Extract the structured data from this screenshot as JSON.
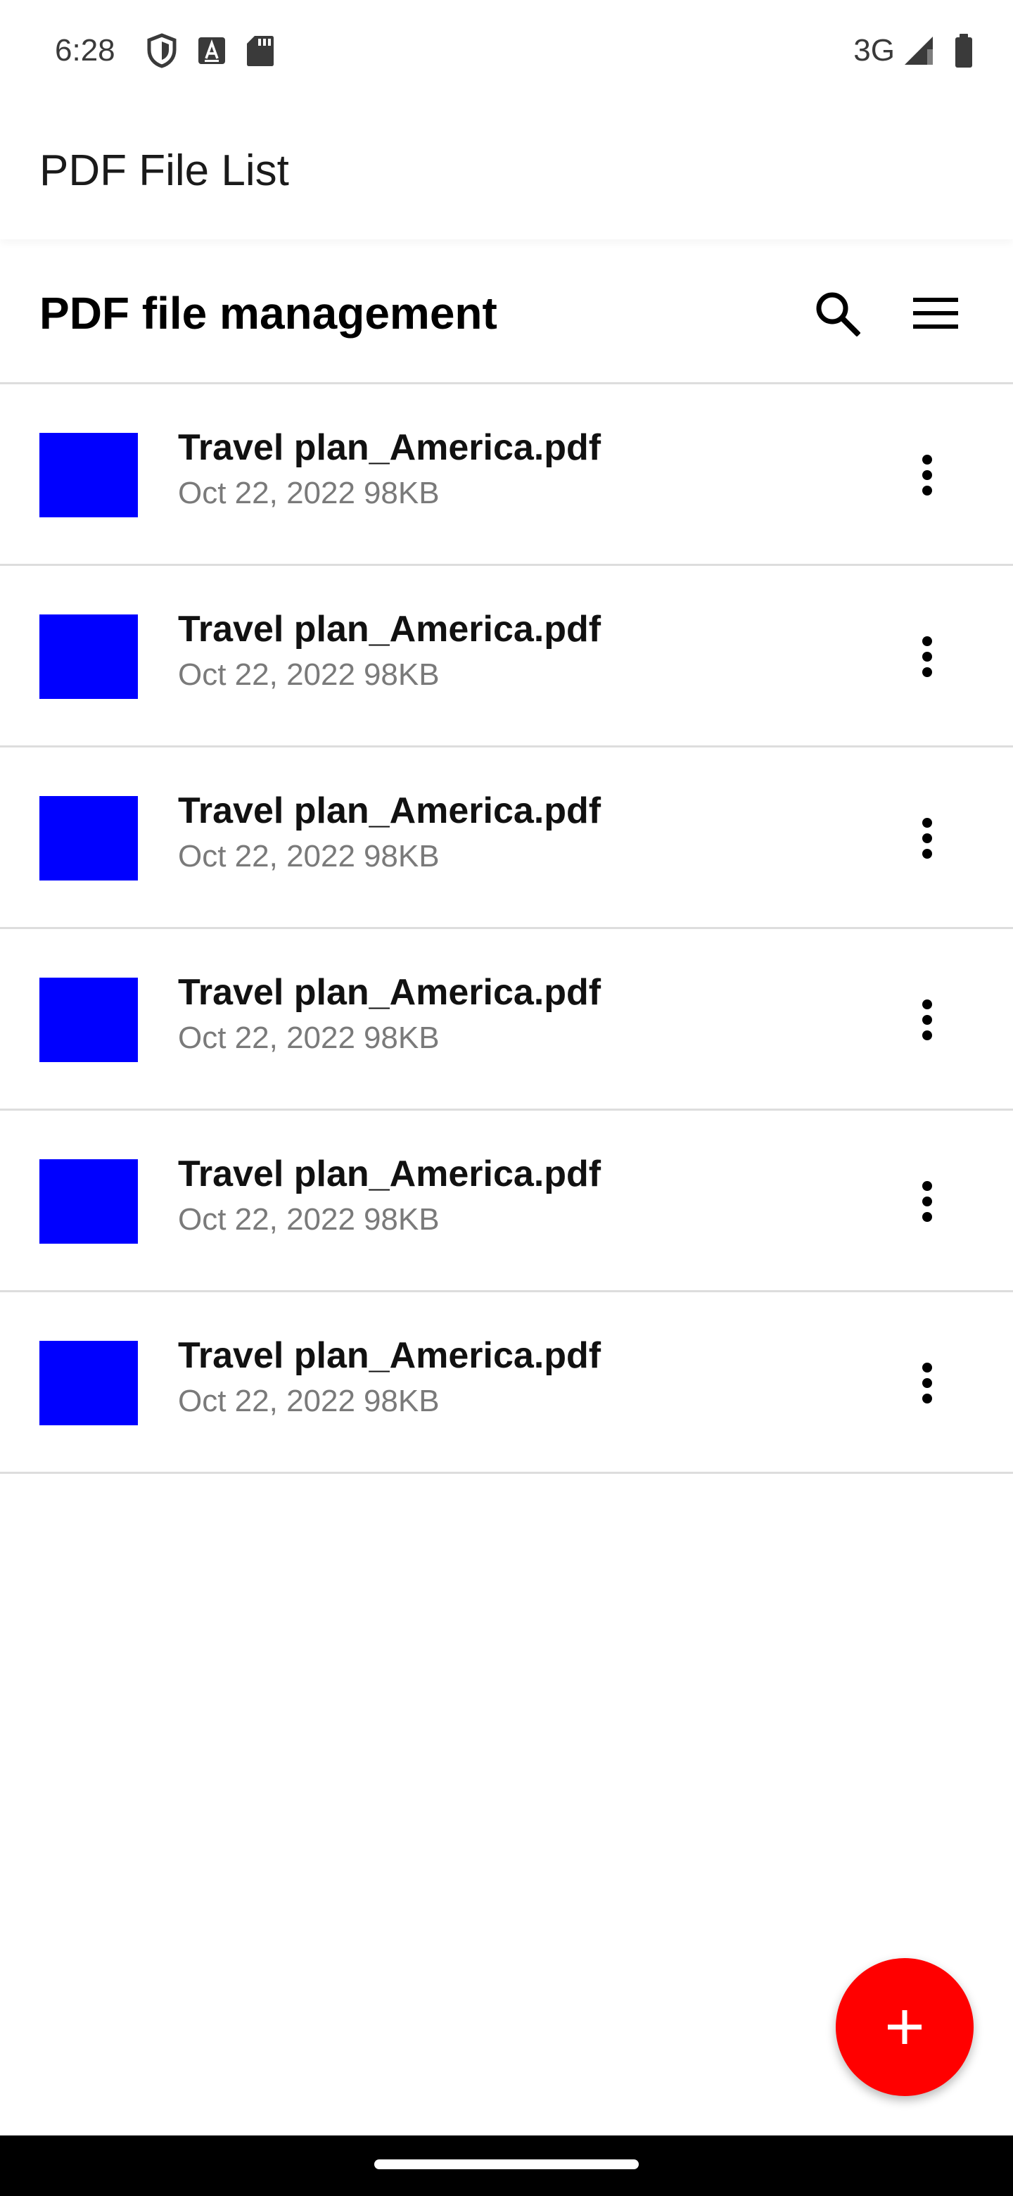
{
  "status_bar": {
    "time": "6:28",
    "network": "3G",
    "icons": [
      "shield-icon",
      "keyboard-a-icon",
      "sd-card-icon",
      "signal-icon",
      "battery-icon"
    ]
  },
  "app_bar": {
    "title": "PDF File List"
  },
  "section": {
    "title": "PDF file management",
    "actions": [
      "search-icon",
      "menu-icon"
    ]
  },
  "files": [
    {
      "name": "Travel plan_America.pdf",
      "date": "Oct 22, 2022",
      "size": "98KB"
    },
    {
      "name": "Travel plan_America.pdf",
      "date": "Oct 22, 2022",
      "size": "98KB"
    },
    {
      "name": "Travel plan_America.pdf",
      "date": "Oct 22, 2022",
      "size": "98KB"
    },
    {
      "name": "Travel plan_America.pdf",
      "date": "Oct 22, 2022",
      "size": "98KB"
    },
    {
      "name": "Travel plan_America.pdf",
      "date": "Oct 22, 2022",
      "size": "98KB"
    },
    {
      "name": "Travel plan_America.pdf",
      "date": "Oct 22, 2022",
      "size": "98KB"
    }
  ],
  "fab": {
    "icon": "plus-icon"
  },
  "colors": {
    "thumbnail": "#0000ff",
    "fab": "#ff0000",
    "nav_bar": "#000000",
    "divider": "#dddddd"
  }
}
